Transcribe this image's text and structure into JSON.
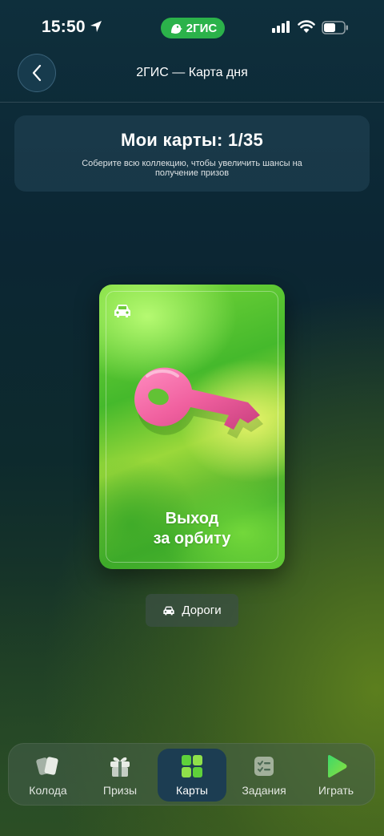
{
  "status_bar": {
    "time": "15:50",
    "app_badge": "2ГИС"
  },
  "header": {
    "title": "2ГИС — Карта дня"
  },
  "collection": {
    "title": "Мои карты: 1/35",
    "subtitle": "Соберите всю коллекцию, чтобы увеличить шансы на получение призов"
  },
  "card": {
    "title": "Выход\nза орбиту",
    "category_icon": "car-icon",
    "illustration": "key-icon"
  },
  "category_chip": {
    "label": "Дороги",
    "icon": "car-icon"
  },
  "bottom_nav": {
    "items": [
      {
        "label": "Колода",
        "icon": "cards-deck-icon",
        "active": false
      },
      {
        "label": "Призы",
        "icon": "gift-icon",
        "active": false
      },
      {
        "label": "Карты",
        "icon": "cards-grid-icon",
        "active": true
      },
      {
        "label": "Задания",
        "icon": "checklist-icon",
        "active": false
      },
      {
        "label": "Играть",
        "icon": "play-icon",
        "active": false
      }
    ]
  },
  "colors": {
    "brand_green": "#2bb24a",
    "nav_active": "#1c3d52",
    "key_pink": "#f06aa6"
  }
}
